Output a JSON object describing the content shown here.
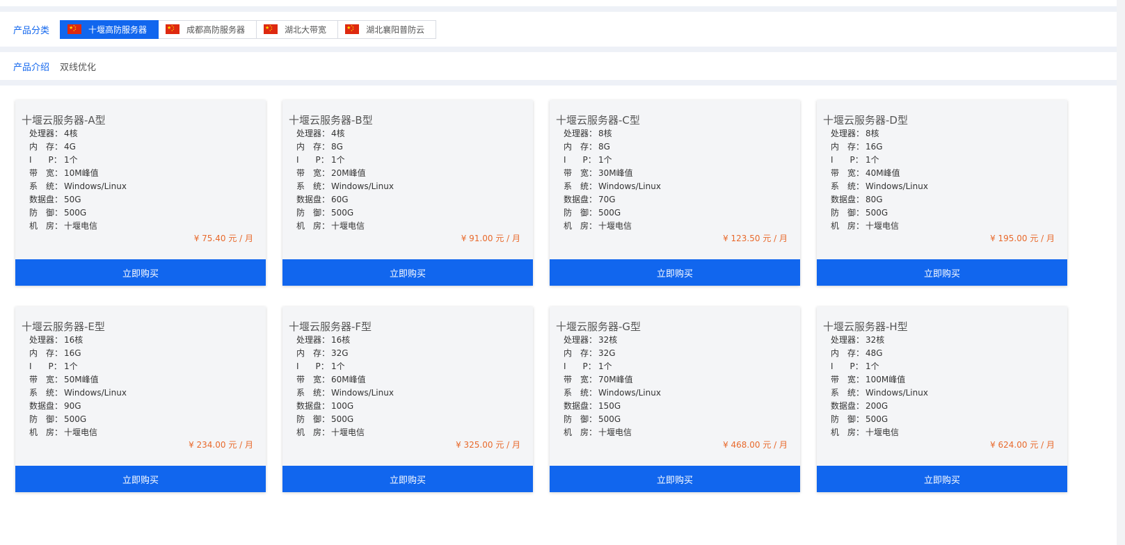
{
  "category_bar": {
    "label": "产品分类",
    "tabs": [
      {
        "label": "十堰高防服务器",
        "active": true
      },
      {
        "label": "成都高防服务器",
        "active": false
      },
      {
        "label": "湖北大带宽",
        "active": false
      },
      {
        "label": "湖北襄阳普防云",
        "active": false
      }
    ]
  },
  "intro_bar": {
    "label": "产品介绍",
    "text": "双线优化"
  },
  "spec_keys": {
    "cpu": "处理器：",
    "mem": "内　存：",
    "ip": "I　　P：",
    "bw": "带　宽：",
    "os": "系　统：",
    "disk": "数据盘：",
    "def": "防　御：",
    "room": "机　房："
  },
  "buy_label": "立即购买",
  "products": [
    {
      "name": "十堰云服务器-A型",
      "cpu": "4核",
      "mem": "4G",
      "ip": "1个",
      "bw": "10M峰值",
      "os": "Windows/Linux",
      "disk": "50G",
      "def": "500G",
      "room": "十堰电信",
      "price": "¥ 75.40 元 / 月"
    },
    {
      "name": "十堰云服务器-B型",
      "cpu": "4核",
      "mem": "8G",
      "ip": "1个",
      "bw": "20M峰值",
      "os": "Windows/Linux",
      "disk": "60G",
      "def": "500G",
      "room": "十堰电信",
      "price": "¥ 91.00 元 / 月"
    },
    {
      "name": "十堰云服务器-C型",
      "cpu": "8核",
      "mem": "8G",
      "ip": "1个",
      "bw": "30M峰值",
      "os": "Windows/Linux",
      "disk": "70G",
      "def": "500G",
      "room": "十堰电信",
      "price": "¥ 123.50 元 / 月"
    },
    {
      "name": "十堰云服务器-D型",
      "cpu": "8核",
      "mem": "16G",
      "ip": "1个",
      "bw": "40M峰值",
      "os": "Windows/Linux",
      "disk": "80G",
      "def": "500G",
      "room": "十堰电信",
      "price": "¥ 195.00 元 / 月"
    },
    {
      "name": "十堰云服务器-E型",
      "cpu": "16核",
      "mem": "16G",
      "ip": "1个",
      "bw": "50M峰值",
      "os": "Windows/Linux",
      "disk": "90G",
      "def": "500G",
      "room": "十堰电信",
      "price": "¥ 234.00 元 / 月"
    },
    {
      "name": "十堰云服务器-F型",
      "cpu": "16核",
      "mem": "32G",
      "ip": "1个",
      "bw": "60M峰值",
      "os": "Windows/Linux",
      "disk": "100G",
      "def": "500G",
      "room": "十堰电信",
      "price": "¥ 325.00 元 / 月"
    },
    {
      "name": "十堰云服务器-G型",
      "cpu": "32核",
      "mem": "32G",
      "ip": "1个",
      "bw": "70M峰值",
      "os": "Windows/Linux",
      "disk": "150G",
      "def": "500G",
      "room": "十堰电信",
      "price": "¥ 468.00 元 / 月"
    },
    {
      "name": "十堰云服务器-H型",
      "cpu": "32核",
      "mem": "48G",
      "ip": "1个",
      "bw": "100M峰值",
      "os": "Windows/Linux",
      "disk": "200G",
      "def": "500G",
      "room": "十堰电信",
      "price": "¥ 624.00 元 / 月"
    }
  ],
  "colors": {
    "accent": "#1166ee",
    "price": "#e8692b",
    "flag_red": "#de2910",
    "flag_star": "#ffde00"
  },
  "icons": {
    "tab_flag": "china-flag-icon"
  }
}
